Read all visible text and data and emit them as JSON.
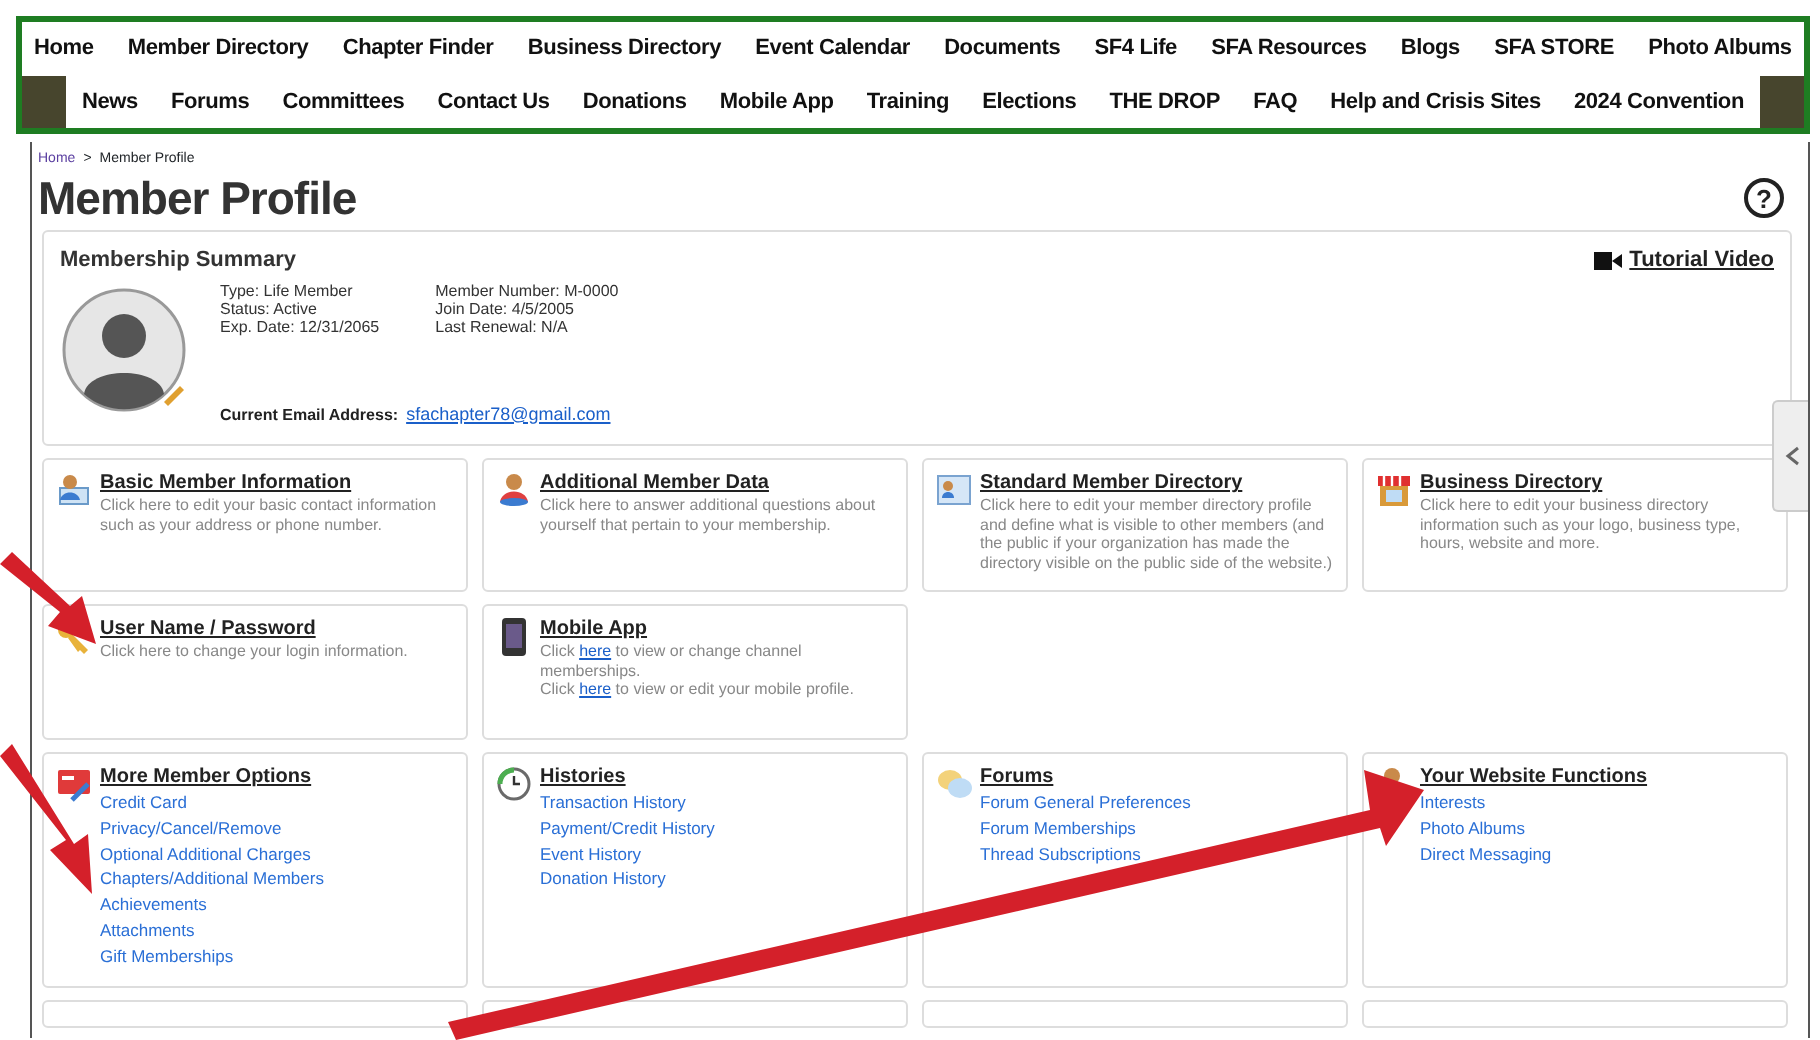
{
  "top_nav": {
    "main_links": [
      "Home",
      "Member Directory",
      "Chapter Finder",
      "Business Directory",
      "Event Calendar",
      "Documents",
      "SF4 Life",
      "SFA Resources",
      "Blogs",
      "SFA STORE",
      "Photo Albums"
    ],
    "secondary_links": [
      "News",
      "Forums",
      "Committees",
      "Contact Us",
      "Donations",
      "Mobile App",
      "Training",
      "Elections",
      "THE DROP",
      "FAQ",
      "Help and Crisis Sites",
      "2024 Convention"
    ]
  },
  "breadcrumb": [
    {
      "text": "Home",
      "kind": "link"
    },
    {
      "text": ">",
      "kind": "separator"
    },
    {
      "text": "Member Profile",
      "kind": "current"
    }
  ],
  "page_title": "Member Profile",
  "help_button": "?",
  "summary": {
    "title": "Membership Summary",
    "tutorial_video": "Tutorial Video",
    "details": [
      [
        "Type: Life Member",
        "Status: Active",
        "Exp. Date: 12/31/2065"
      ],
      [
        "Member Number: M-0000",
        "Join Date: 4/5/2005",
        "Last Renewal: N/A"
      ]
    ],
    "email_label": "Current Email Address:",
    "email": "sfachapter78@gmail.com"
  },
  "tiles": [
    [
      {
        "kind": "text",
        "title": "Basic Member Information",
        "description": [
          [
            {
              "text": "Click here to edit your basic contact information such as your address or phone number."
            }
          ]
        ]
      },
      {
        "kind": "text",
        "title": "Additional Member Data",
        "description": [
          [
            {
              "text": "Click here to answer additional questions about yourself that pertain to your membership."
            }
          ]
        ]
      },
      {
        "kind": "text",
        "title": "Standard Member Directory",
        "description": [
          [
            {
              "text": "Click here to edit your member directory profile and define what is visible to other members (and the public if your organization has made the directory visible on the public side of the website.)"
            }
          ]
        ]
      },
      {
        "kind": "text",
        "title": "Business Directory",
        "description": [
          [
            {
              "text": "Click here to edit your business directory information such as your logo, business type, hours, website and more."
            }
          ]
        ]
      }
    ],
    [
      {
        "kind": "text",
        "title": "User Name / Password",
        "description": [
          [
            {
              "text": "Click here to change your login information."
            }
          ]
        ]
      },
      {
        "kind": "text",
        "title": "Mobile App",
        "description": [
          [
            {
              "text": "Click "
            },
            {
              "text": "here",
              "link": true
            },
            {
              "text": " to view or change channel memberships."
            }
          ],
          [
            {
              "text": "Click "
            },
            {
              "text": "here",
              "link": true
            },
            {
              "text": " to view or edit your mobile profile."
            }
          ]
        ]
      }
    ],
    [
      {
        "kind": "links",
        "title": "More Member Options",
        "links": [
          "Credit Card",
          "Privacy/Cancel/Remove",
          "Optional Additional Charges",
          "Chapters/Additional Members",
          "Achievements",
          "Attachments",
          "Gift Memberships"
        ]
      },
      {
        "kind": "links",
        "title": "Histories",
        "links": [
          "Transaction History",
          "Payment/Credit History",
          "Event History",
          "Donation History"
        ]
      },
      {
        "kind": "links",
        "title": "Forums",
        "links": [
          "Forum General Preferences",
          "Forum Memberships",
          "Thread Subscriptions"
        ]
      },
      {
        "kind": "links",
        "title": "Your Website Functions",
        "links": [
          "Interests",
          "Photo Albums",
          "Direct Messaging"
        ]
      }
    ],
    [
      {
        "kind": "empty"
      },
      {
        "kind": "empty"
      },
      {
        "kind": "empty"
      },
      {
        "kind": "empty"
      }
    ]
  ],
  "annotations": [
    {
      "kind": "arrow"
    },
    {
      "kind": "arrow"
    },
    {
      "kind": "arrow"
    }
  ]
}
